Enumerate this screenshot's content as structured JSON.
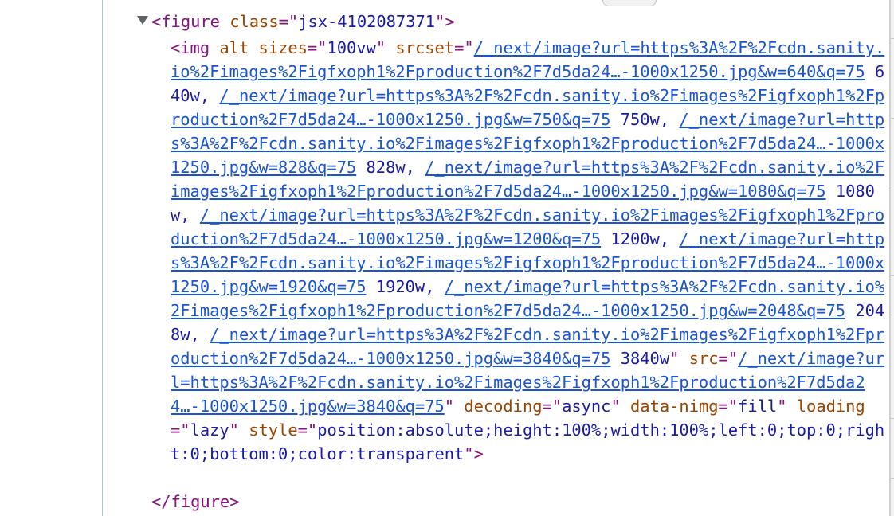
{
  "panel": {
    "type": "devtools-elements",
    "colors": {
      "tag": "#881280",
      "attribute_name": "#994500",
      "attribute_value": "#1a1aa6",
      "link": "#1a55d1",
      "gutter": "#a8c0e8"
    }
  },
  "figure": {
    "expander_icon": "triangle-down-icon",
    "open_tag": "<figure",
    "class_attr": "class",
    "class_value": "jsx-4102087371",
    "close_bracket": ">",
    "close_tag": "</figure>"
  },
  "img": {
    "open_tag": "<img",
    "attr_alt": "alt",
    "attr_sizes": "sizes",
    "sizes_value": "100vw",
    "attr_srcset": "srcset",
    "srcset": [
      {
        "url": "/_next/image?url=https%3A%2F%2Fcdn.sanity.io%2Fimages%2Figfxoph1%2Fproduction%2F7d5da24…-1000x1250.jpg&w=640&q=75",
        "descriptor": "640w"
      },
      {
        "url": "/_next/image?url=https%3A%2F%2Fcdn.sanity.io%2Fimages%2Figfxoph1%2Fproduction%2F7d5da24…-1000x1250.jpg&w=750&q=75",
        "descriptor": "750w"
      },
      {
        "url": "/_next/image?url=https%3A%2F%2Fcdn.sanity.io%2Fimages%2Figfxoph1%2Fproduction%2F7d5da24…-1000x1250.jpg&w=828&q=75",
        "descriptor": "828w"
      },
      {
        "url": "/_next/image?url=https%3A%2F%2Fcdn.sanity.io%2Fimages%2Figfxoph1%2Fproduction%2F7d5da24…-1000x1250.jpg&w=1080&q=75",
        "descriptor": "1080w"
      },
      {
        "url": "/_next/image?url=https%3A%2F%2Fcdn.sanity.io%2Fimages%2Figfxoph1%2Fproduction%2F7d5da24…-1000x1250.jpg&w=1200&q=75",
        "descriptor": "1200w"
      },
      {
        "url": "/_next/image?url=https%3A%2F%2Fcdn.sanity.io%2Fimages%2Figfxoph1%2Fproduction%2F7d5da24…-1000x1250.jpg&w=1920&q=75",
        "descriptor": "1920w"
      },
      {
        "url": "/_next/image?url=https%3A%2F%2Fcdn.sanity.io%2Fimages%2Figfxoph1%2Fproduction%2F7d5da24…-1000x1250.jpg&w=2048&q=75",
        "descriptor": "2048w"
      },
      {
        "url": "/_next/image?url=https%3A%2F%2Fcdn.sanity.io%2Fimages%2Figfxoph1%2Fproduction%2F7d5da24…-1000x1250.jpg&w=3840&q=75",
        "descriptor": "3840w"
      }
    ],
    "attr_src": "src",
    "src_value": "/_next/image?url=https%3A%2F%2Fcdn.sanity.io%2Fimages%2Figfxoph1%2Fproduction%2F7d5da24…-1000x1250.jpg&w=3840&q=75",
    "attr_decoding": "decoding",
    "decoding_value": "async",
    "attr_data_nimg": "data-nimg",
    "data_nimg_value": "fill",
    "attr_loading": "loading",
    "loading_value": "lazy",
    "attr_style": "style",
    "style_value": "position:absolute;height:100%;width:100%;left:0;top:0;right:0;bottom:0;color:transparent",
    "close_bracket": ">"
  }
}
